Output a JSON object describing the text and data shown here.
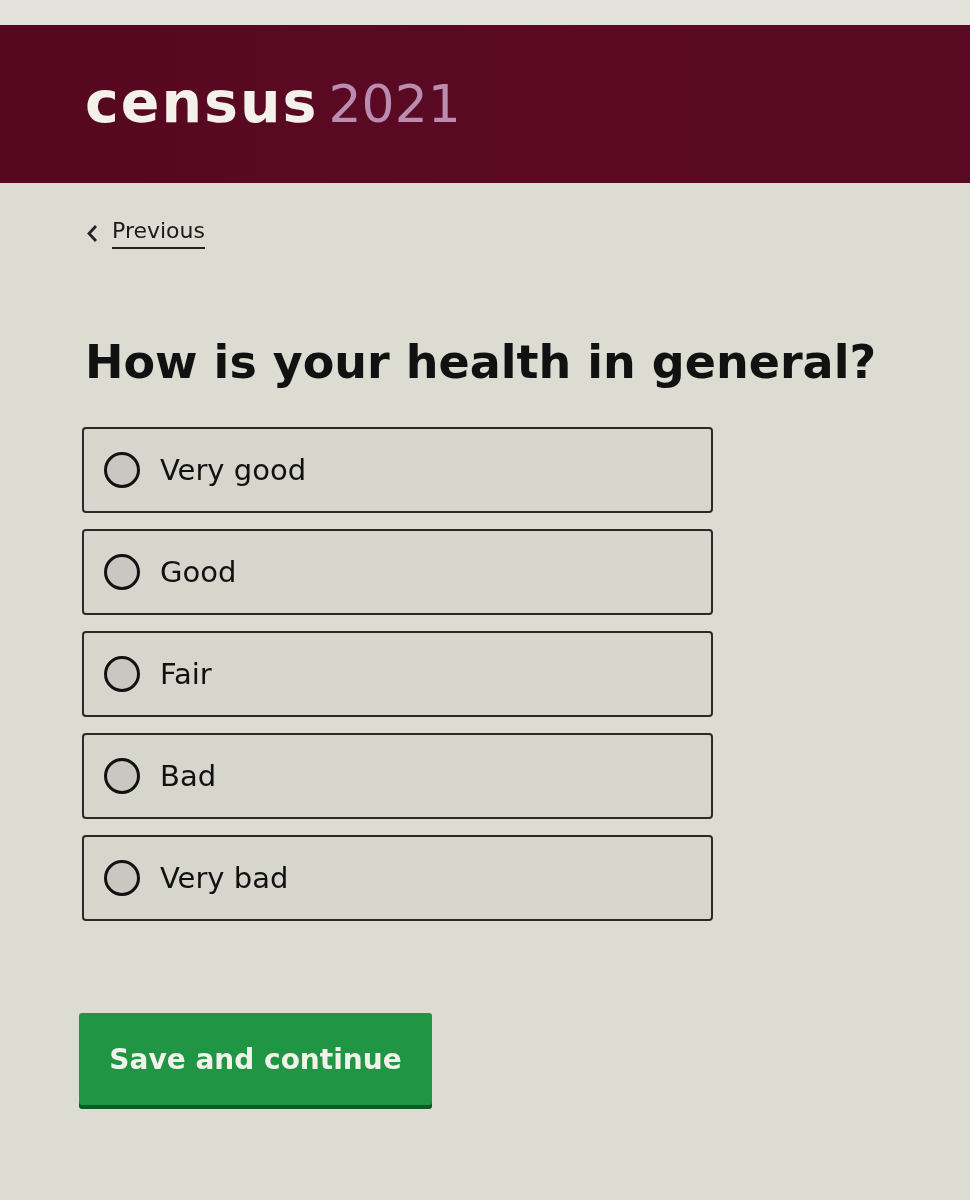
{
  "header": {
    "logo_word": "census",
    "logo_year": "2021"
  },
  "back_link": {
    "label": "Previous"
  },
  "question": {
    "title": "How is your health in general?",
    "options": [
      {
        "label": "Very good",
        "selected": false
      },
      {
        "label": "Good",
        "selected": false
      },
      {
        "label": "Fair",
        "selected": false
      },
      {
        "label": "Bad",
        "selected": false
      },
      {
        "label": "Very bad",
        "selected": false
      }
    ]
  },
  "submit_button": {
    "label": "Save and continue"
  }
}
